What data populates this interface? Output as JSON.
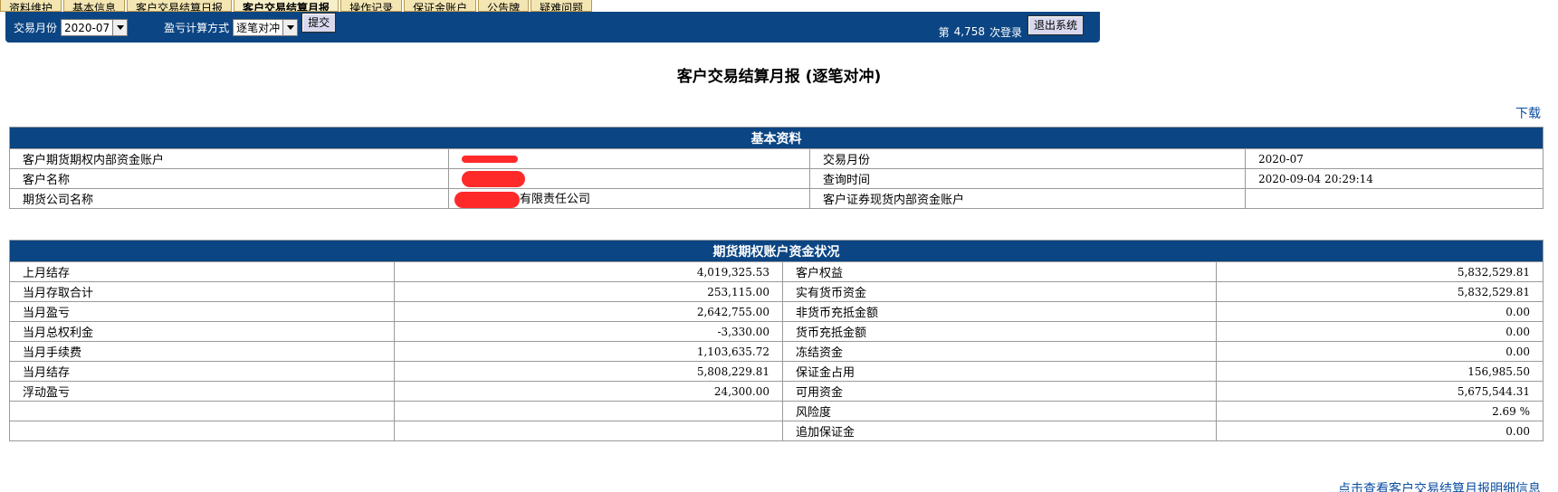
{
  "tabs": [
    "资料维护",
    "基本信息",
    "客户交易结算日报",
    "客户交易结算月报",
    "操作记录",
    "保证金账户",
    "公告牌",
    "疑难问题"
  ],
  "toolbar": {
    "month_label": "交易月份",
    "month_value": "2020-07",
    "calc_label": "盈亏计算方式",
    "calc_value": "逐笔对冲",
    "submit_label": "提交",
    "login_prefix": "第",
    "login_count": "4,758",
    "login_suffix": "次登录",
    "logout_label": "退出系统"
  },
  "title": "客户交易结算月报 (逐笔对冲)",
  "download_label": "下载",
  "basic": {
    "header": "基本资料",
    "rows": [
      {
        "l1": "客户期货期权内部资金账户",
        "v1": "",
        "l2": "交易月份",
        "v2": "2020-07"
      },
      {
        "l1": "客户名称",
        "v1": "",
        "l2": "查询时间",
        "v2": "2020-09-04 20:29:14"
      },
      {
        "l1": "期货公司名称",
        "v1": "有限责任公司",
        "l2": "客户证券现货内部资金账户",
        "v2": ""
      }
    ]
  },
  "fund": {
    "header": "期货期权账户资金状况",
    "rows": [
      {
        "l1": "上月结存",
        "v1": "4,019,325.53",
        "l2": "客户权益",
        "v2": "5,832,529.81"
      },
      {
        "l1": "当月存取合计",
        "v1": "253,115.00",
        "l2": "实有货币资金",
        "v2": "5,832,529.81"
      },
      {
        "l1": "当月盈亏",
        "v1": "2,642,755.00",
        "l2": "非货币充抵金额",
        "v2": "0.00"
      },
      {
        "l1": "当月总权利金",
        "v1": "-3,330.00",
        "l2": "货币充抵金额",
        "v2": "0.00"
      },
      {
        "l1": "当月手续费",
        "v1": "1,103,635.72",
        "l2": "冻结资金",
        "v2": "0.00"
      },
      {
        "l1": "当月结存",
        "v1": "5,808,229.81",
        "l2": "保证金占用",
        "v2": "156,985.50"
      },
      {
        "l1": "浮动盈亏",
        "v1": "24,300.00",
        "l2": "可用资金",
        "v2": "5,675,544.31"
      },
      {
        "l1": "",
        "v1": "",
        "l2": "风险度",
        "v2": "2.69 %"
      },
      {
        "l1": "",
        "v1": "",
        "l2": "追加保证金",
        "v2": "0.00"
      }
    ]
  },
  "detail_link": "点击查看客户交易结算月报明细信息",
  "colors": {
    "header_blue": "#0b4583",
    "link_blue": "#0b4da2",
    "tab_bg": "#f3e6b2",
    "redaction": "#fe2a2a"
  }
}
